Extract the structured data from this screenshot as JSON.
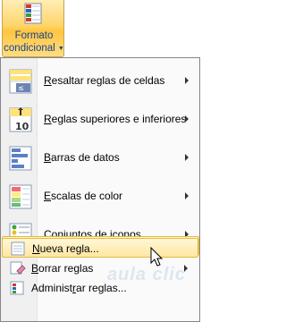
{
  "ribbon": {
    "button_line1": "Formato",
    "button_line2": "condicional",
    "button_icon": "conditional-format-icon"
  },
  "menu": {
    "items": [
      {
        "mnemonic": "R",
        "rest": "esaltar reglas de celdas",
        "icon": "highlight-cells-rules-icon",
        "submenu": true
      },
      {
        "mnemonic": "R",
        "rest": "eglas superiores e inferiores",
        "icon": "top-bottom-rules-icon",
        "submenu": true
      },
      {
        "mnemonic": "B",
        "rest": "arras de datos",
        "icon": "data-bars-icon",
        "submenu": true
      },
      {
        "mnemonic": "E",
        "rest": "scalas de color",
        "icon": "color-scales-icon",
        "submenu": true
      },
      {
        "mnemonic": "C",
        "rest": "onjuntos de iconos",
        "icon": "icon-sets-icon",
        "submenu": true
      }
    ],
    "actions": [
      {
        "mnemonic": "N",
        "rest": "ueva regla...",
        "icon": "new-rule-icon",
        "highlighted": true
      },
      {
        "mnemonic": "B",
        "rest": "orrar reglas",
        "icon": "clear-rules-icon",
        "submenu": true
      },
      {
        "pre": "Administ",
        "mnemonic": "r",
        "rest": "ar reglas...",
        "icon": "manage-rules-icon"
      }
    ]
  },
  "watermark": "aula clic",
  "colors": {
    "highlight": "#ffe7a2",
    "accent_blue": "#15428b"
  }
}
